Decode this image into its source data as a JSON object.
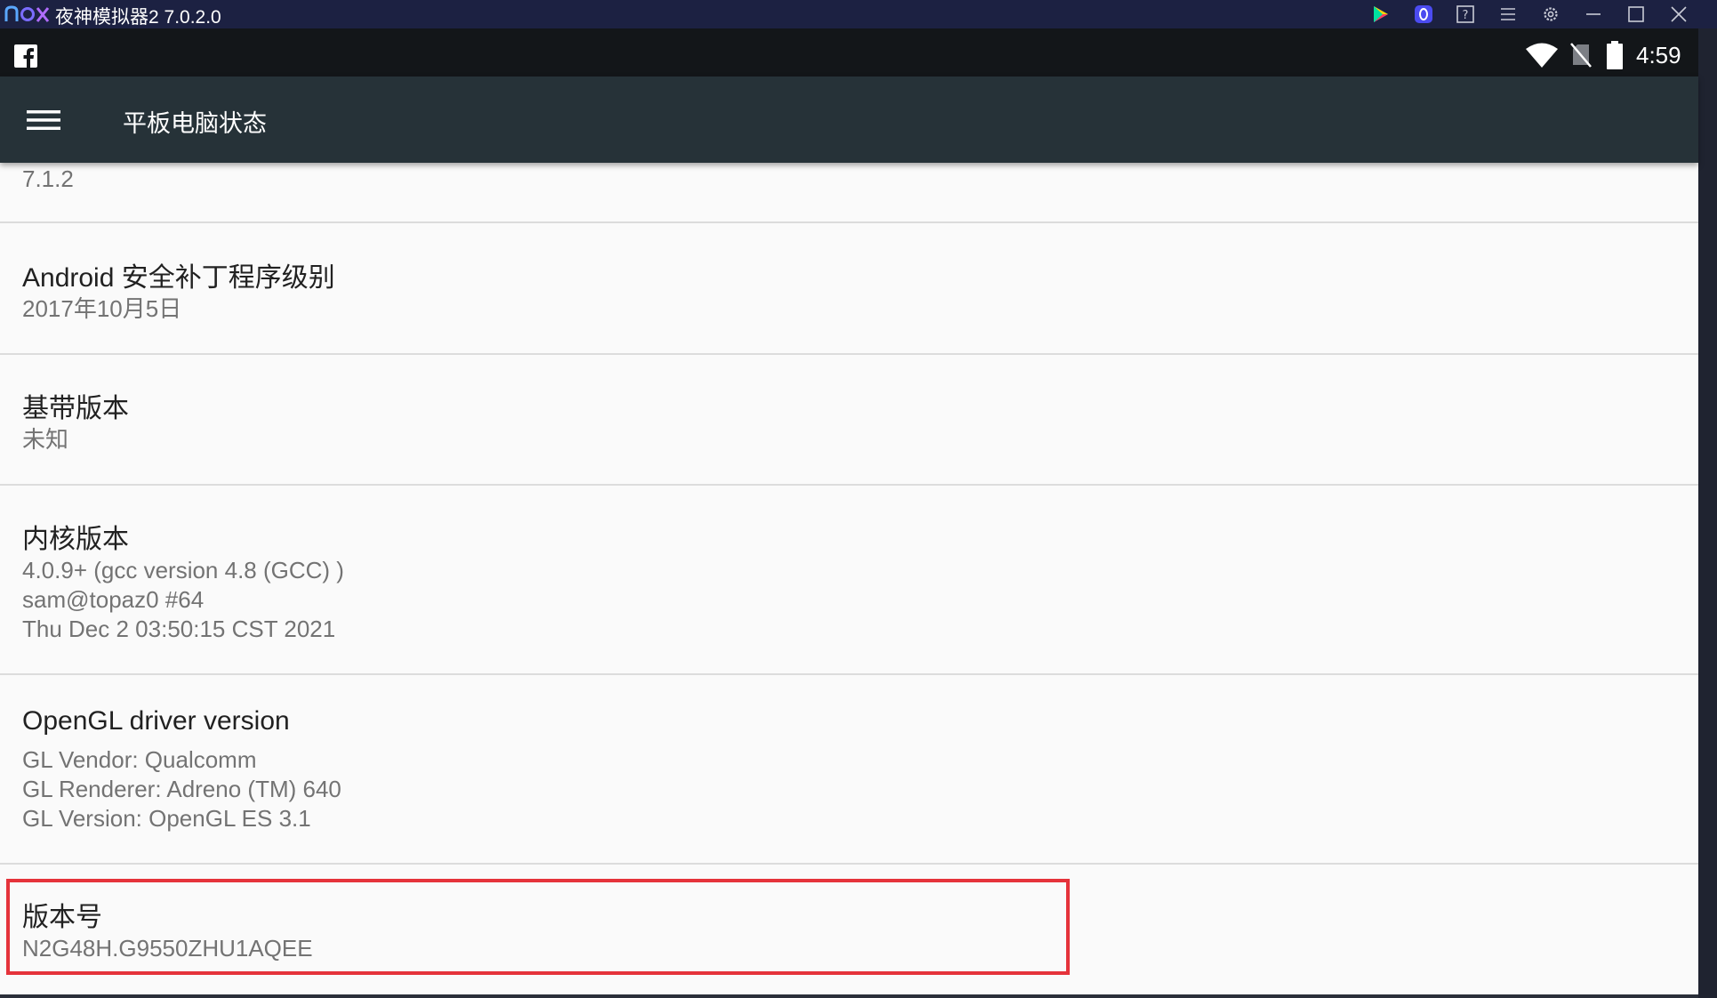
{
  "window": {
    "brand_logo": "nox",
    "title": "夜神模拟器2 7.0.2.0",
    "titlebar_icons": [
      "play-store-icon",
      "app-badge-icon",
      "help-icon",
      "menu-lines-icon",
      "settings-gear-icon",
      "minimize-icon",
      "maximize-icon",
      "close-icon"
    ]
  },
  "statusbar": {
    "left_icon": "facebook-icon",
    "icons": [
      "wifi-icon",
      "no-sim-icon",
      "battery-icon"
    ],
    "time": "4:59"
  },
  "toolbar": {
    "menu_icon": "hamburger-menu-icon",
    "title": "平板电脑状态"
  },
  "preferences": [
    {
      "title": "",
      "summary": [
        "7.1.2"
      ]
    },
    {
      "title": "Android 安全补丁程序级别",
      "summary": [
        "2017年10月5日"
      ]
    },
    {
      "title": "基带版本",
      "summary": [
        "未知"
      ]
    },
    {
      "title": "内核版本",
      "summary": [
        "4.0.9+ (gcc version 4.8 (GCC) )",
        "sam@topaz0 #64",
        "Thu Dec 2 03:50:15 CST 2021"
      ]
    },
    {
      "title": "OpenGL driver version",
      "summary": [
        "GL Vendor: Qualcomm",
        "GL Renderer: Adreno (TM) 640",
        "GL Version: OpenGL ES 3.1"
      ]
    },
    {
      "title": "版本号",
      "summary": [
        "N2G48H.G9550ZHU1AQEE"
      ],
      "highlighted": true
    }
  ],
  "colors": {
    "titlebar_bg": "#1c2142",
    "statusbar_bg": "#131619",
    "toolbar_bg": "#263238",
    "content_bg": "#fafafa",
    "highlight_border": "#e5333b"
  }
}
